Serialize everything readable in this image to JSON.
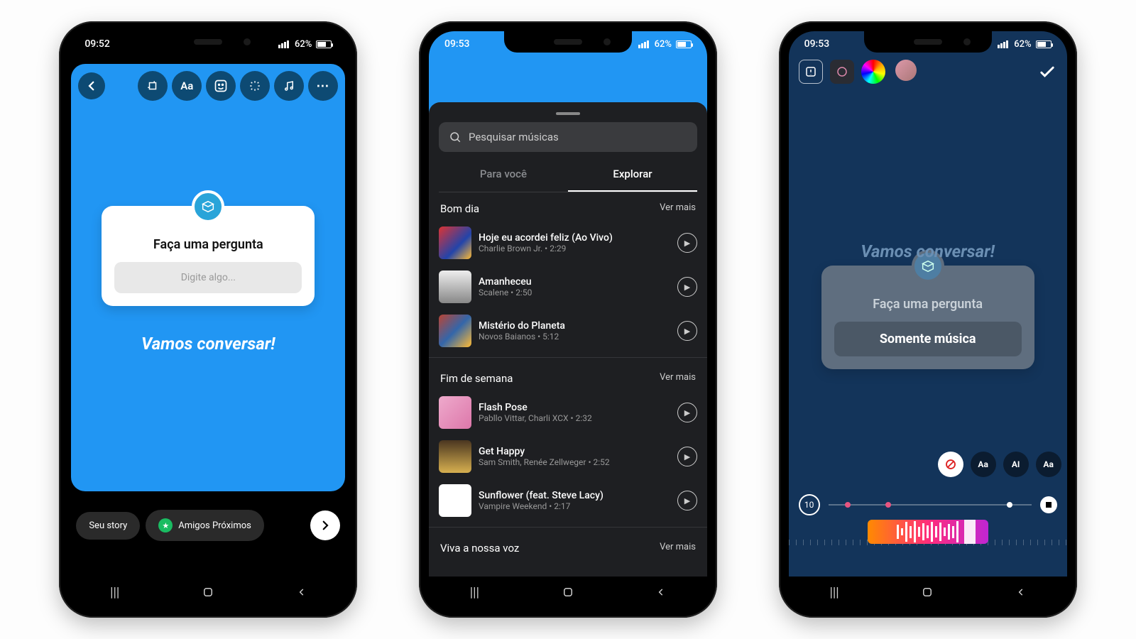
{
  "status": {
    "time_1": "09:52",
    "time_2": "09:53",
    "time_3": "09:53",
    "battery": "62%"
  },
  "accent_color": "#2196f3",
  "phone1": {
    "question_title": "Faça uma pergunta",
    "question_placeholder": "Digite algo...",
    "caption": "Vamos conversar!",
    "share_story": "Seu story",
    "share_close": "Amigos Próximos"
  },
  "phone2": {
    "search_placeholder": "Pesquisar músicas",
    "tab_foryou": "Para você",
    "tab_explore": "Explorar",
    "more": "Ver mais",
    "sections": [
      {
        "title": "Bom dia",
        "tracks": [
          {
            "title": "Hoje eu acordei feliz (Ao Vivo)",
            "sub": "Charlie Brown Jr. • 2:29"
          },
          {
            "title": "Amanheceu",
            "sub": "Scalene • 2:50"
          },
          {
            "title": "Mistério do Planeta",
            "sub": "Novos Baianos • 5:12"
          }
        ]
      },
      {
        "title": "Fim de semana",
        "tracks": [
          {
            "title": "Flash Pose",
            "sub": "Pabllo Vittar, Charli XCX • 2:32"
          },
          {
            "title": "Get Happy",
            "sub": "Sam Smith, Renée Zellweger • 2:52"
          },
          {
            "title": "Sunflower (feat. Steve Lacy)",
            "sub": "Vampire Weekend • 2:17"
          }
        ]
      },
      {
        "title": "Viva a nossa voz"
      }
    ]
  },
  "phone3": {
    "question_title": "Faça uma pergunta",
    "music_only": "Somente música",
    "caption": "Vamos conversar!",
    "length": "10",
    "style_labels": [
      "Aa",
      "AI",
      "Aa"
    ]
  }
}
